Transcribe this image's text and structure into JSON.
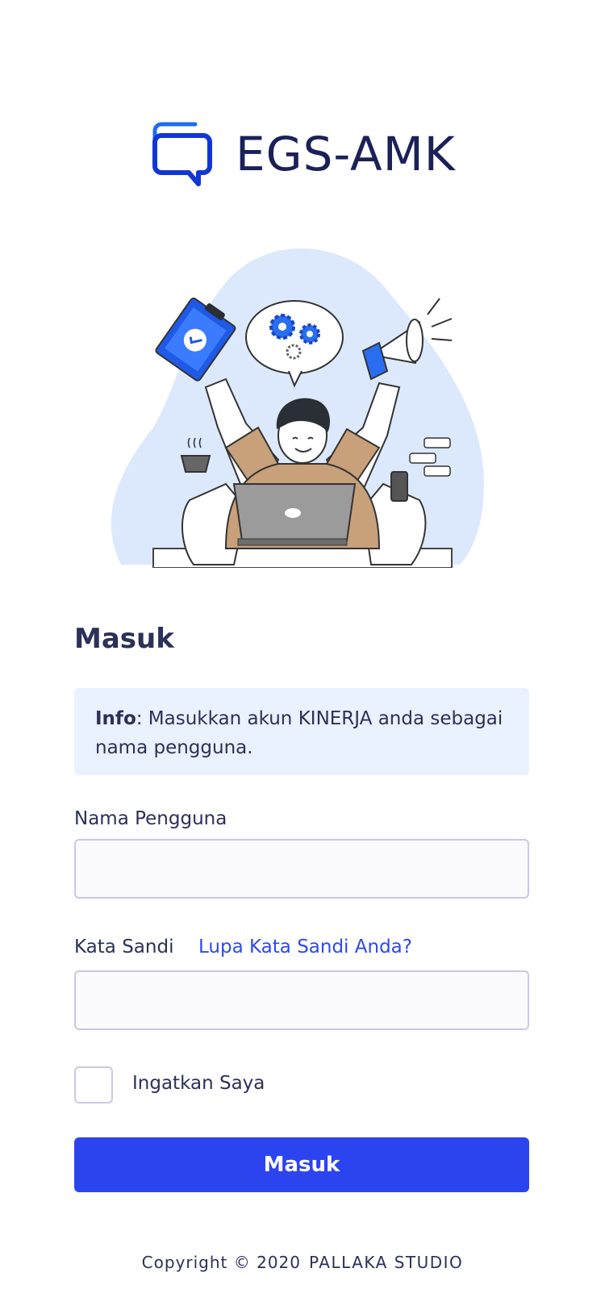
{
  "brand": {
    "name": "EGS-AMK",
    "icon": "chat-bubble-icon",
    "color": "#1b2158",
    "accent": "#1749e6"
  },
  "illustration": {
    "name": "multitasking-person-illustration"
  },
  "form": {
    "title": "Masuk",
    "info": {
      "label": "Info",
      "text": ": Masukkan akun KINERJA anda sebagai nama pengguna."
    },
    "username": {
      "label": "Nama Pengguna",
      "value": "",
      "placeholder": ""
    },
    "password": {
      "label": "Kata Sandi",
      "forgot_link": "Lupa Kata Sandi Anda?",
      "value": "",
      "placeholder": ""
    },
    "remember": {
      "label": "Ingatkan Saya",
      "checked": false
    },
    "submit_label": "Masuk",
    "accent_color": "#2c44f0",
    "info_bg": "#e9f2fe"
  },
  "footer": {
    "copyright": "Copyright © 2020",
    "studio": "PALLAKA STUDIO"
  }
}
